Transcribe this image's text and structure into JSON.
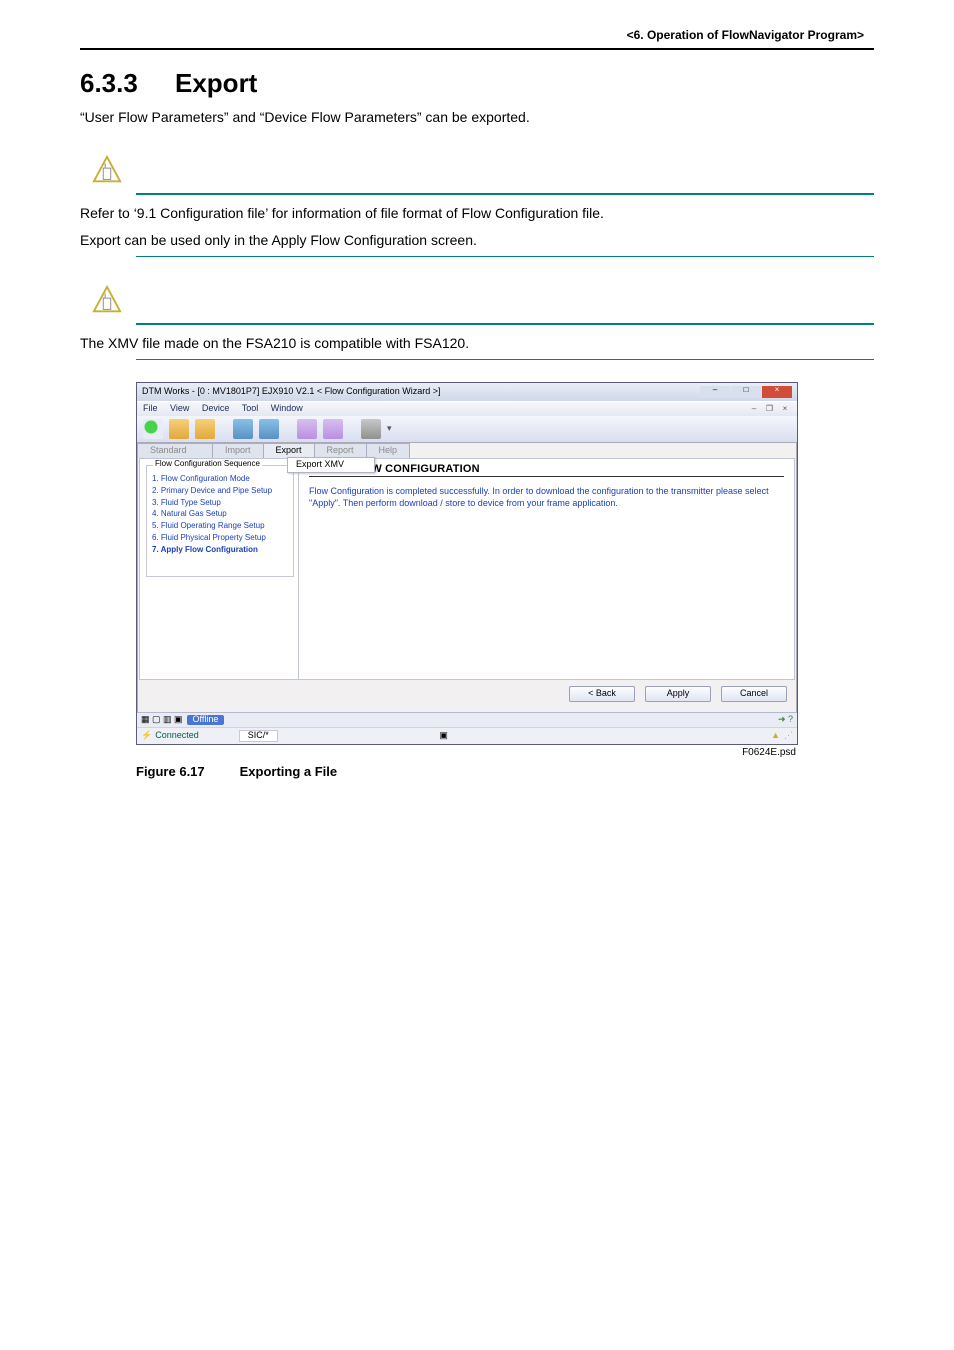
{
  "header": {
    "right": "<6. Operation of FlowNavigator Program>"
  },
  "section": {
    "num": "6.3.3",
    "title": "Export"
  },
  "intro": "“User Flow Parameters” and “Device Flow Parameters” can be exported.",
  "note1_l1": "Refer to ‘9.1 Configuration file’ for information of file format of Flow Configuration file.",
  "note1_l2": "Export can be used only in the Apply Flow Configuration screen.",
  "note2": "The XMV file made on the FSA210 is compatible with FSA120.",
  "figure": {
    "caption_label": "Figure 6.17",
    "caption_text": "Exporting a File",
    "filename": "F0624E.psd"
  },
  "app": {
    "title": "DTM Works - [0 : MV1801P7] EJX910 V2.1 < Flow Configuration Wizard >]",
    "menus": [
      "File",
      "View",
      "Device",
      "Tool",
      "Window"
    ],
    "tabs": [
      "Import",
      "Export",
      "Report",
      "Help"
    ],
    "exp_unused": "Standard",
    "submenu": "Export XMV",
    "side_legend": "Flow Configuration Sequence",
    "side_items": [
      "1. Flow Configuration Mode",
      "2. Primary Device and Pipe Setup",
      "3. Fluid Type Setup",
      "4. Natural Gas Setup",
      "5. Fluid Operating Range Setup",
      "6. Fluid Physical Property Setup",
      "7. Apply Flow Configuration"
    ],
    "content_title": "APPLY FLOW CONFIGURATION",
    "content_msg": "Flow Configuration is completed successfully. In order to download the configuration to the transmitter please select \"Apply\". Then perform download / store to device from your frame application.",
    "buttons": {
      "back": "< Back",
      "apply": "Apply",
      "cancel": "Cancel"
    },
    "status_offline": "Offline",
    "status_conn": "Connected",
    "status_sic": "SIC/*"
  }
}
